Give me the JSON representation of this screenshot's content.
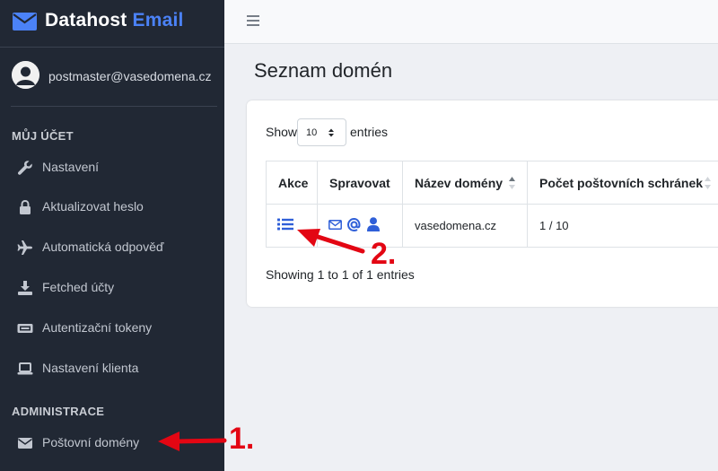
{
  "brand": {
    "name_main": "Datahost",
    "name_accent": "Email",
    "logo": "envelope-icon"
  },
  "user": {
    "email": "postmaster@vasedomena.cz",
    "avatar": "user-circle-icon"
  },
  "sidebar": {
    "section_account": "MŮJ ÚČET",
    "account_items": [
      {
        "label": "Nastavení",
        "icon": "wrench-icon"
      },
      {
        "label": "Aktualizovat heslo",
        "icon": "lock-icon"
      },
      {
        "label": "Automatická odpověď",
        "icon": "plane-icon"
      },
      {
        "label": "Fetched účty",
        "icon": "download-icon"
      },
      {
        "label": "Autentizační tokeny",
        "icon": "ticket-icon"
      },
      {
        "label": "Nastavení klienta",
        "icon": "laptop-icon"
      }
    ],
    "section_admin": "ADMINISTRACE",
    "admin_items": [
      {
        "label": "Poštovní domény",
        "icon": "envelope-icon"
      }
    ]
  },
  "topbar": {
    "menu_icon": "hamburger-icon"
  },
  "page": {
    "title": "Seznam domén",
    "length_prefix": "Show",
    "length_value": "10",
    "length_suffix": "entries",
    "columns": [
      "Akce",
      "Spravovat",
      "Název domény",
      "Počet poštovních schránek"
    ],
    "rows": [
      {
        "domain": "vasedomena.cz",
        "mailboxes": "1 / 10"
      }
    ],
    "info": "Showing 1 to 1 of 1 entries"
  },
  "annotations": {
    "step1": "1.",
    "step2": "2.",
    "color": "#e30613"
  },
  "colors": {
    "sidebar": "#212834",
    "accent": "#4b82f7",
    "link": "#2f5fd8"
  }
}
